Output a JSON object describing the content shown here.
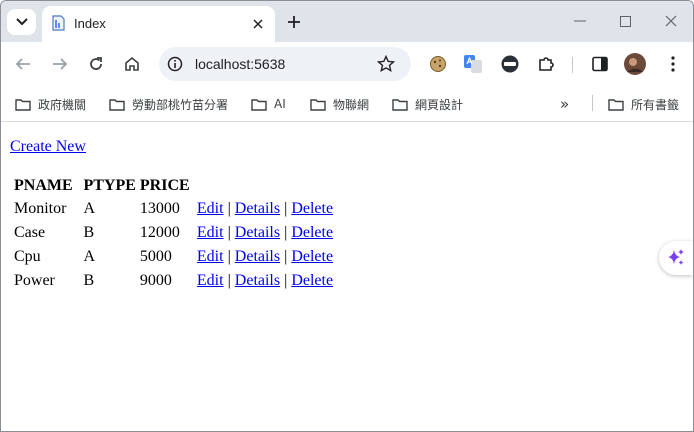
{
  "browser": {
    "tab": {
      "title": "Index"
    },
    "address": {
      "url": "localhost:5638"
    },
    "bookmarks": [
      {
        "label": "政府機關"
      },
      {
        "label": "勞動部桃竹苗分署"
      },
      {
        "label": "AI"
      },
      {
        "label": "物聯網"
      },
      {
        "label": "網頁設計"
      }
    ],
    "bookmarks_overflow": "»",
    "all_bookmarks": "所有書籤"
  },
  "page": {
    "create_link": "Create New",
    "columns": [
      "PNAME",
      "PTYPE",
      "PRICE"
    ],
    "rows": [
      {
        "pname": "Monitor",
        "ptype": "A",
        "price": "13000"
      },
      {
        "pname": "Case",
        "ptype": "B",
        "price": "12000"
      },
      {
        "pname": "Cpu",
        "ptype": "A",
        "price": "5000"
      },
      {
        "pname": "Power",
        "ptype": "B",
        "price": "9000"
      }
    ],
    "actions": {
      "edit": "Edit",
      "details": "Details",
      "delete": "Delete",
      "separator": "|"
    }
  },
  "colors": {
    "link": "#0000ee",
    "tabstrip": "#dfe3ea",
    "omnibox": "#eef1f6",
    "sparkle": "#7b3ff2"
  }
}
